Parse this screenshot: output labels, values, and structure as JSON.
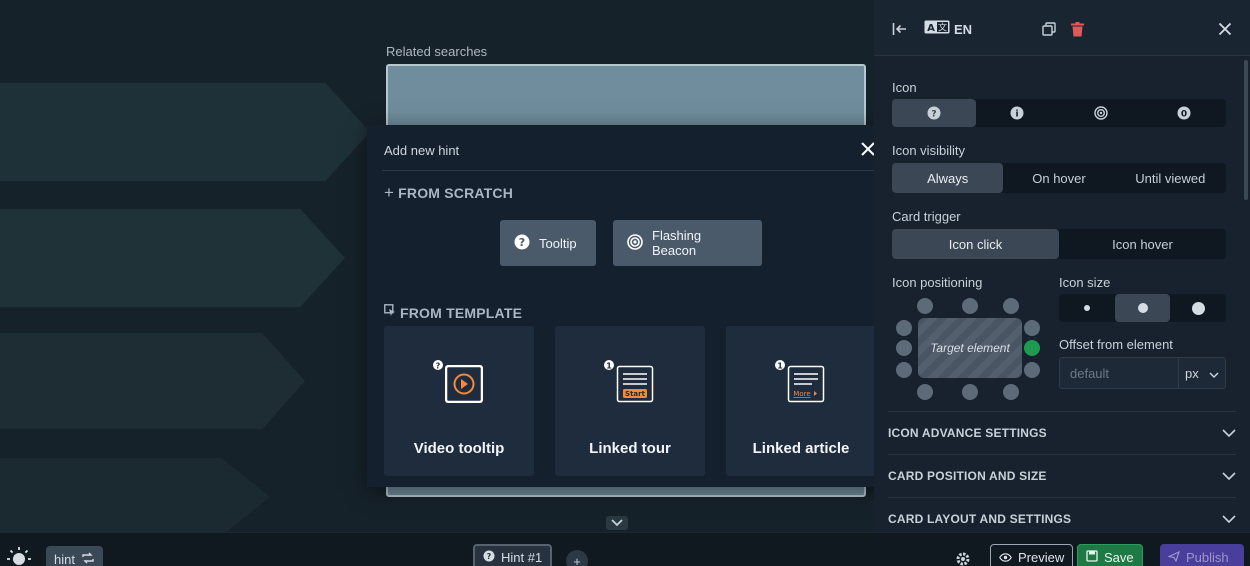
{
  "canvas": {
    "related_label": "Related searches"
  },
  "modal": {
    "title": "Add new hint",
    "from_scratch": "FROM SCRATCH",
    "from_template": "FROM TEMPLATE",
    "scratch_options": [
      {
        "label": "Tooltip",
        "icon": "question-circle-icon"
      },
      {
        "label": "Flashing Beacon",
        "icon": "beacon-icon"
      }
    ],
    "templates": [
      {
        "label": "Video tooltip",
        "icon": "video-tooltip-icon",
        "badge": "?"
      },
      {
        "label": "Linked tour",
        "icon": "linked-tour-icon",
        "badge": "1",
        "button_text": "Start"
      },
      {
        "label": "Linked article",
        "icon": "linked-article-icon",
        "badge": "1",
        "link_text": "More"
      }
    ]
  },
  "panel": {
    "lang": "EN",
    "icon_label": "Icon",
    "icon_options": [
      "?",
      "i",
      "◎",
      "0"
    ],
    "icon_selected": 0,
    "visibility_label": "Icon visibility",
    "visibility_options": [
      "Always",
      "On hover",
      "Until viewed"
    ],
    "visibility_selected": 0,
    "trigger_label": "Card trigger",
    "trigger_options": [
      "Icon click",
      "Icon hover"
    ],
    "trigger_selected": 0,
    "positioning_label": "Icon positioning",
    "target_label": "Target element",
    "size_label": "Icon size",
    "size_selected": 1,
    "offset_label": "Offset from element",
    "offset_placeholder": "default",
    "offset_unit": "px",
    "accordions": [
      "ICON ADVANCE SETTINGS",
      "CARD POSITION AND SIZE",
      "CARD LAYOUT AND SETTINGS"
    ]
  },
  "bottom": {
    "hint_tag": "hint",
    "hint_tab": "Hint #1",
    "preview": "Preview",
    "save": "Save",
    "publish": "Publish"
  },
  "colors": {
    "accent_green": "#1e9b4e",
    "save_green": "#1e7a45",
    "publish_purple": "#4a3e9c",
    "delete_red": "#e05a5a"
  }
}
